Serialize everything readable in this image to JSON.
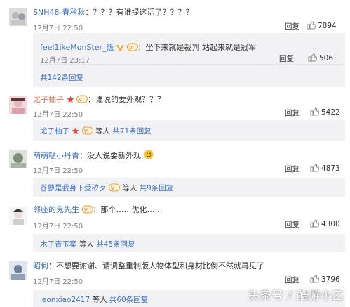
{
  "comments": [
    {
      "user": "SNH48-春秋秋",
      "text": "：？？？有谁提这话了？？？？",
      "time": "12月7日 22:50",
      "reply": "回复",
      "likes": "7894",
      "sub": {
        "user": "feel1ikeMonSter_飯",
        "text": "：坐下来就是裁判 站起来就是冠军",
        "time": "12月7日 23:17",
        "reply": "回复",
        "likes": "506"
      },
      "total": "共142条回复"
    },
    {
      "user": "尤子柚子",
      "text": "：谁说的要外观？？？",
      "time": "12月7日 22:50",
      "reply": "回复",
      "likes": "5422",
      "sub_user": "尤子柚子",
      "sub_others": "等人",
      "total": "共71条回复"
    },
    {
      "user": "萌萌哒小丹青",
      "text": "：没人说要新外观",
      "time": "12月7日 22:50",
      "reply": "回复",
      "likes": "4873",
      "sub_user": "苍蓼是我身下受矽歹",
      "sub_others": "等人",
      "total": "共9条回复"
    },
    {
      "user": "邻座的鬼先生",
      "text": "：那个……优化……",
      "time": "12月7日 22:50",
      "reply": "回复",
      "likes": "4300",
      "sub_user": "木子青玉案",
      "sub_others": "等人",
      "total": "共45条回复"
    },
    {
      "user": "昭何",
      "text": "：不想要谢谢、请调整重制版人物体型和身材比例不然就再见了",
      "time": "12月7日 22:50",
      "reply": "回复",
      "likes": "3796",
      "sub_user": "leonxiao2417",
      "sub_others": "等人",
      "total": "共60条回复"
    }
  ],
  "watermark": "头条号 / 酷游小乙",
  "colors": {
    "accent_orange": "#eb7350",
    "link_blue": "#3a6fc4"
  }
}
